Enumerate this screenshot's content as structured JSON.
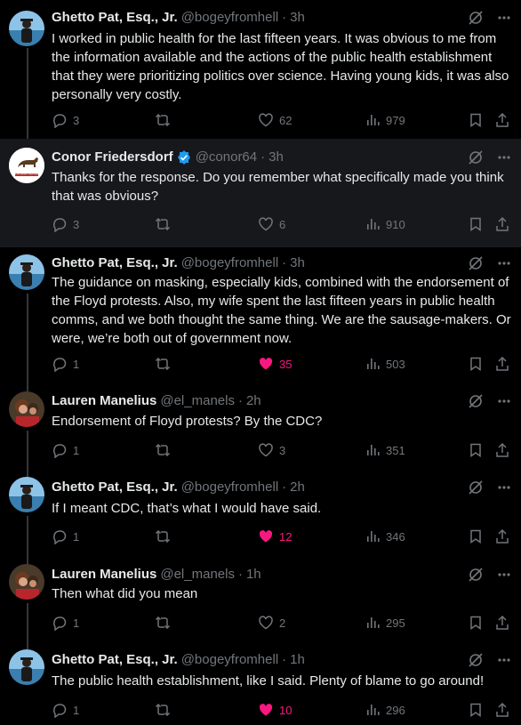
{
  "tweets": [
    {
      "name": "Ghetto Pat, Esq., Jr.",
      "handle": "@bogeyfromhell",
      "sep": "·",
      "time": "3h",
      "text": "I worked in public health for the last fifteen years. It was obvious to me from the information available and the actions of the public health establishment that they were prioritizing politics over science. Having young kids, it was also personally very costly.",
      "replies": "3",
      "reposts": "",
      "likes": "62",
      "views": "979",
      "liked": false
    },
    {
      "name": "Conor Friedersdorf",
      "handle": "@conor64",
      "sep": "·",
      "time": "3h",
      "verified": true,
      "avatar_caption": "CALIFORNIA REPUBLIC",
      "text": "Thanks for the response. Do you remember what specifically made you think that was obvious?",
      "replies": "3",
      "reposts": "",
      "likes": "6",
      "views": "910",
      "liked": false
    },
    {
      "name": "Ghetto Pat, Esq., Jr.",
      "handle": "@bogeyfromhell",
      "sep": "·",
      "time": "3h",
      "text": "The guidance on masking, especially kids, combined with the endorsement of the Floyd protests. Also, my wife spent the last fifteen years in public health comms, and we both thought the same thing. We are the sausage-makers. Or were, we’re both out of government now.",
      "replies": "1",
      "reposts": "",
      "likes": "35",
      "views": "503",
      "liked": true
    },
    {
      "name": "Lauren Manelius",
      "handle": "@el_manels",
      "sep": "·",
      "time": "2h",
      "text": "Endorsement of Floyd protests? By the CDC?",
      "replies": "1",
      "reposts": "",
      "likes": "3",
      "views": "351",
      "liked": false
    },
    {
      "name": "Ghetto Pat, Esq., Jr.",
      "handle": "@bogeyfromhell",
      "sep": "·",
      "time": "2h",
      "text": "If I meant CDC, that’s what I would have said.",
      "replies": "1",
      "reposts": "",
      "likes": "12",
      "views": "346",
      "liked": true
    },
    {
      "name": "Lauren Manelius",
      "handle": "@el_manels",
      "sep": "·",
      "time": "1h",
      "text": "Then what did you mean",
      "replies": "1",
      "reposts": "",
      "likes": "2",
      "views": "295",
      "liked": false
    },
    {
      "name": "Ghetto Pat, Esq., Jr.",
      "handle": "@bogeyfromhell",
      "sep": "·",
      "time": "1h",
      "text": "The public health establishment, like I said. Plenty of blame to go around!",
      "replies": "1",
      "reposts": "",
      "likes": "10",
      "views": "296",
      "liked": true
    }
  ],
  "colors": {
    "background": "#000000",
    "highlight_background": "#16181c",
    "text": "#e7e9ea",
    "muted": "#71767b",
    "like_active": "#f91880",
    "verified": "#1d9bf0",
    "thread_line": "#333639"
  },
  "icons": {
    "reply": "reply-icon",
    "repost": "repost-icon",
    "like": "heart-icon",
    "views": "views-icon",
    "bookmark": "bookmark-icon",
    "share": "share-icon",
    "grok": "grok-icon",
    "more": "more-icon",
    "verified": "verified-badge-icon"
  }
}
